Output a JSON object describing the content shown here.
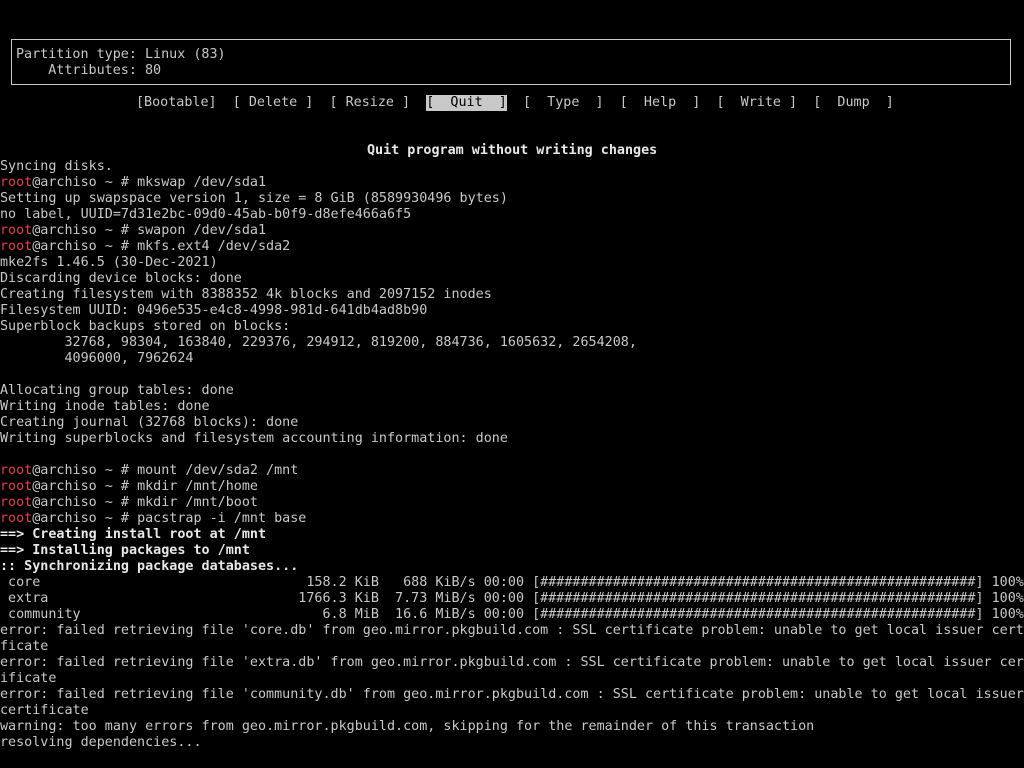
{
  "cfdisk": {
    "partition_type": "Partition type: Linux (83)",
    "attributes": "    Attributes: 80",
    "menu": [
      {
        "label": "[Bootable]",
        "selected": false
      },
      {
        "label": "[ Delete ]",
        "selected": false
      },
      {
        "label": "[ Resize ]",
        "selected": false
      },
      {
        "label": "[  Quit  ]",
        "selected": true
      },
      {
        "label": "[  Type  ]",
        "selected": false
      },
      {
        "label": "[  Help  ]",
        "selected": false
      },
      {
        "label": "[  Write ]",
        "selected": false
      },
      {
        "label": "[  Dump  ]",
        "selected": false
      }
    ],
    "hint": "Quit program without writing changes"
  },
  "prompt": {
    "user": "root",
    "host_path": "@archiso ~ # "
  },
  "terminal": {
    "lines": [
      {
        "text": "Syncing disks."
      },
      {
        "prompt": true,
        "cmd": "mkswap /dev/sda1"
      },
      {
        "text": "Setting up swapspace version 1, size = 8 GiB (8589930496 bytes)"
      },
      {
        "text": "no label, UUID=7d31e2bc-09d0-45ab-b0f9-d8efe466a6f5"
      },
      {
        "prompt": true,
        "cmd": "swapon /dev/sda1"
      },
      {
        "prompt": true,
        "cmd": "mkfs.ext4 /dev/sda2"
      },
      {
        "text": "mke2fs 1.46.5 (30-Dec-2021)"
      },
      {
        "text": "Discarding device blocks: done"
      },
      {
        "text": "Creating filesystem with 8388352 4k blocks and 2097152 inodes"
      },
      {
        "text": "Filesystem UUID: 0496e535-e4c8-4998-981d-641db4ad8b90"
      },
      {
        "text": "Superblock backups stored on blocks:"
      },
      {
        "text": "        32768, 98304, 163840, 229376, 294912, 819200, 884736, 1605632, 2654208,"
      },
      {
        "text": "        4096000, 7962624"
      },
      {
        "text": ""
      },
      {
        "text": "Allocating group tables: done"
      },
      {
        "text": "Writing inode tables: done"
      },
      {
        "text": "Creating journal (32768 blocks): done"
      },
      {
        "text": "Writing superblocks and filesystem accounting information: done"
      },
      {
        "text": ""
      },
      {
        "prompt": true,
        "cmd": "mount /dev/sda2 /mnt"
      },
      {
        "prompt": true,
        "cmd": "mkdir /mnt/home"
      },
      {
        "prompt": true,
        "cmd": "mkdir /mnt/boot"
      },
      {
        "prompt": true,
        "cmd": "pacstrap -i /mnt base"
      },
      {
        "text": "==> Creating install root at /mnt",
        "bold": true
      },
      {
        "text": "==> Installing packages to /mnt",
        "bold": true
      },
      {
        "text": ":: Synchronizing package databases...",
        "bold": true
      },
      {
        "text": " core                                 158.2 KiB   688 KiB/s 00:00 [######################################################] 100%"
      },
      {
        "text": " extra                               1766.3 KiB  7.73 MiB/s 00:00 [######################################################] 100%"
      },
      {
        "text": " community                              6.8 MiB  16.6 MiB/s 00:00 [######################################################] 100%"
      },
      {
        "text": "error: failed retrieving file 'core.db' from geo.mirror.pkgbuild.com : SSL certificate problem: unable to get local issuer certi"
      },
      {
        "text": "ficate"
      },
      {
        "text": "error: failed retrieving file 'extra.db' from geo.mirror.pkgbuild.com : SSL certificate problem: unable to get local issuer cert"
      },
      {
        "text": "ificate"
      },
      {
        "text": "error: failed retrieving file 'community.db' from geo.mirror.pkgbuild.com : SSL certificate problem: unable to get local issuer"
      },
      {
        "text": "certificate"
      },
      {
        "text": "warning: too many errors from geo.mirror.pkgbuild.com, skipping for the remainder of this transaction"
      },
      {
        "text": "resolving dependencies..."
      }
    ]
  },
  "colors": {
    "background": "#000000",
    "foreground": "#c8c8c8",
    "root_user": "#e04040"
  }
}
